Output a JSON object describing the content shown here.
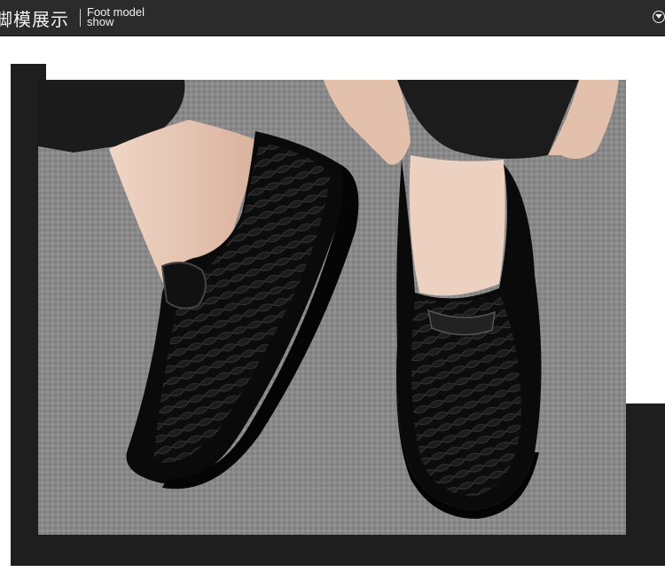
{
  "header": {
    "title_cn": "脚模展示",
    "title_en_line1": "Foot model",
    "title_en_line2": "show",
    "toggle_icon": "chevron-down-circle-icon"
  },
  "photo": {
    "subject": "product-photo",
    "colors": {
      "carpet": "#8a8a8a",
      "shoe": "#0d0d0d",
      "trouser": "#1a1a1a",
      "skin": "#e8c8b4"
    }
  }
}
